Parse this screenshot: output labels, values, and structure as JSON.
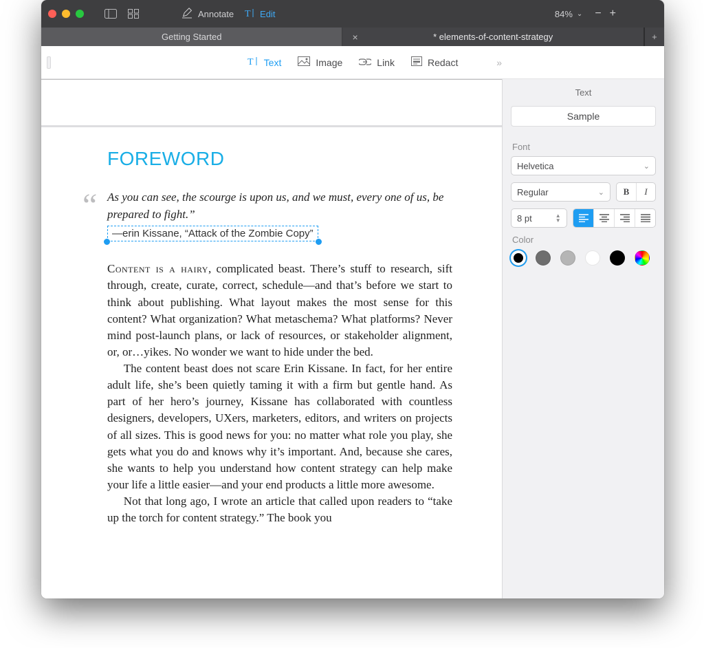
{
  "toolbar": {
    "annotate_label": "Annotate",
    "edit_label": "Edit",
    "zoom_value": "84%"
  },
  "tabs": [
    {
      "label": "Getting Started",
      "active": false
    },
    {
      "label": "* elements-of-content-strategy",
      "active": true
    }
  ],
  "edit_toolbar": {
    "text": "Text",
    "image": "Image",
    "link": "Link",
    "redact": "Redact"
  },
  "inspector": {
    "title": "Text",
    "sample": "Sample",
    "font_label": "Font",
    "font_family": "Helvetica",
    "font_style": "Regular",
    "bold_glyph": "B",
    "italic_glyph": "I",
    "font_size": "8 pt",
    "color_label": "Color",
    "swatches": [
      {
        "name": "black-selected",
        "hex": "#000000",
        "selected": true
      },
      {
        "name": "gray-dark",
        "hex": "#6e6e6e"
      },
      {
        "name": "gray-light",
        "hex": "#b5b5b5"
      },
      {
        "name": "white",
        "hex": "#ffffff"
      },
      {
        "name": "black",
        "hex": "#000000"
      },
      {
        "name": "multicolor",
        "hex": "multicolor"
      }
    ]
  },
  "document": {
    "title": "FOREWORD",
    "quote_line1": "As you can see, the scourge is upon us, and we must, every one of us, be prepared to fight.”",
    "byline_dash": "—",
    "byline_name": "erin Kissane, ",
    "byline_work": "“Attack of the Zombie Copy”",
    "para1_lead": "Content is a hairy",
    "para1_rest": ", complicated beast. There’s stuff to research, sift through, create, curate, correct, schedule—and that’s before we start to think about publishing. What layout makes the most sense for this content? What organization? What metaschema? What platforms? Never mind post-launch plans, or lack of resources, or stakeholder alignment, or, or…yikes. No wonder we want to hide under the bed.",
    "para2": "The content beast does not scare Erin Kissane. In fact, for her entire adult life, she’s been quietly taming it with a firm but gentle hand. As part of her hero’s journey, Kissane has collaborated with countless designers, developers, UXers, marketers, editors, and writers on projects of all sizes. This is good news for you: no matter what role you play, she gets what you do and knows why it’s important. And, because she cares, she wants to help you understand how content strategy can help make your life a little easier—and your end products a little more awesome.",
    "para3": "Not that long ago, I wrote an article that called upon readers to “take up the torch for content strategy.” The book you"
  }
}
